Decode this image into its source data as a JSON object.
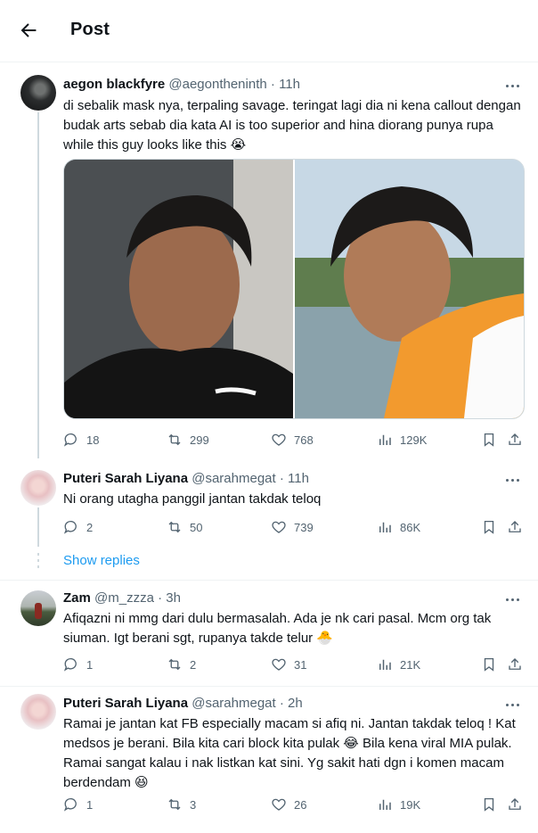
{
  "header": {
    "title": "Post",
    "back_icon": "arrow-left-icon"
  },
  "posts": [
    {
      "name": "aegon blackfyre",
      "handle": "@aegontheninth",
      "time": "11h",
      "text": "di sebalik mask nya, terpaling savage. teringat lagi dia ni kena callout dengan budak arts sebab dia kata AI is too superior and hina diorang punya rupa while this guy looks like this 😭",
      "stats": {
        "replies": "18",
        "reposts": "299",
        "likes": "768",
        "views": "129K"
      }
    },
    {
      "name": "Puteri Sarah Liyana",
      "handle": "@sarahmegat",
      "time": "11h",
      "text": "Ni orang utagha panggil jantan takdak teloq",
      "stats": {
        "replies": "2",
        "reposts": "50",
        "likes": "739",
        "views": "86K"
      }
    },
    {
      "name": "Zam",
      "handle": "@m_zzza",
      "time": "3h",
      "text": "Afiqazni ni mmg dari dulu bermasalah. Ada je nk cari pasal. Mcm org tak siuman. Igt berani sgt, rupanya takde telur 🐣",
      "stats": {
        "replies": "1",
        "reposts": "2",
        "likes": "31",
        "views": "21K"
      }
    },
    {
      "name": "Puteri Sarah Liyana",
      "handle": "@sarahmegat",
      "time": "2h",
      "text": "Ramai je jantan kat FB especially macam si afiq ni. Jantan takdak teloq ! Kat medsos je berani. Bila kita cari block kita pulak 😂 Bila kena viral MIA pulak. Ramai sangat kalau i nak listkan kat sini. Yg sakit hati dgn i komen macam berdendam 😆",
      "stats": {
        "replies": "1",
        "reposts": "3",
        "likes": "26",
        "views": "19K"
      }
    }
  ],
  "show_replies": "Show replies",
  "separator": "·",
  "colors": {
    "text": "#0f1419",
    "muted": "#536471",
    "link": "#1d9bf0",
    "border": "#eff3f4"
  }
}
